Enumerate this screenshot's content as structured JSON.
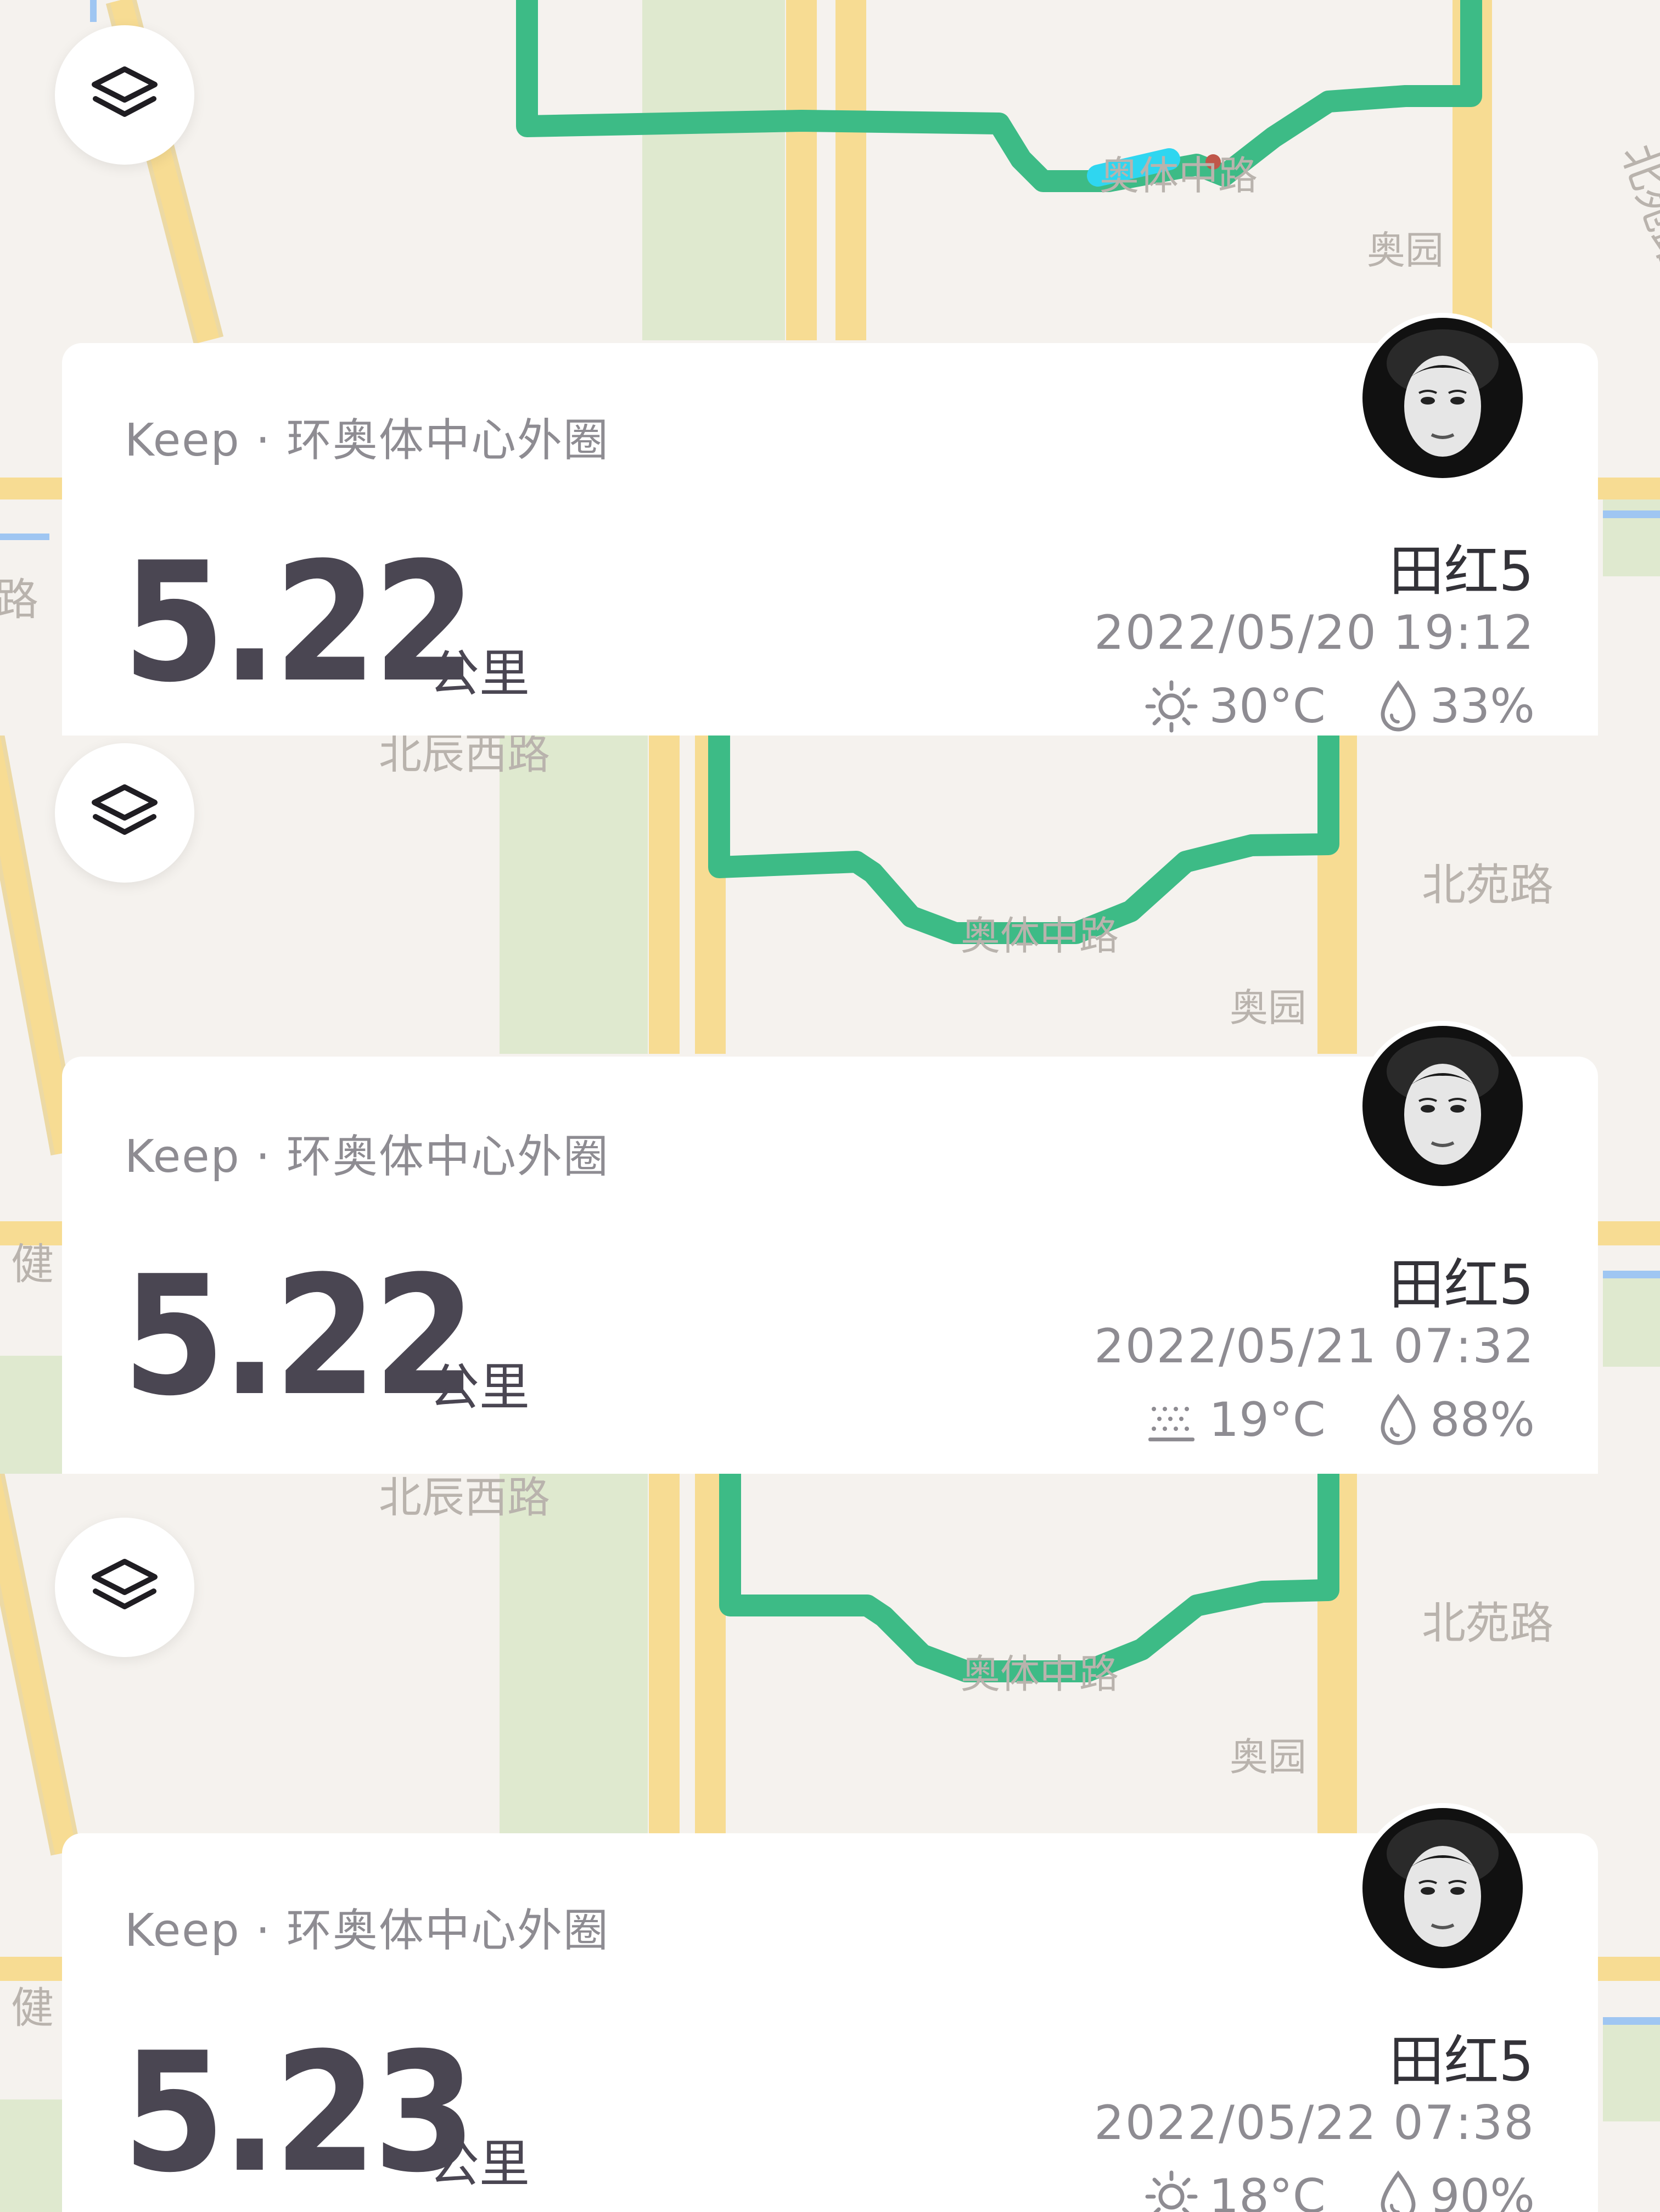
{
  "cards": [
    {
      "source": "Keep · 环奥体中心外圈",
      "distance": "5.22",
      "unit": "公里",
      "user": "田红5",
      "datetime": "2022/05/20 19:12",
      "weather_icon": "sun-icon",
      "temperature": "30°C",
      "humidity": "33%"
    },
    {
      "source": "Keep · 环奥体中心外圈",
      "distance": "5.22",
      "unit": "公里",
      "user": "田红5",
      "datetime": "2022/05/21 07:32",
      "weather_icon": "haze-icon",
      "temperature": "19°C",
      "humidity": "88%"
    },
    {
      "source": "Keep · 环奥体中心外圈",
      "distance": "5.23",
      "unit": "公里",
      "user": "田红5",
      "datetime": "2022/05/22 07:38",
      "weather_icon": "sun-icon",
      "temperature": "18°C",
      "humidity": "90%"
    }
  ],
  "map_labels": {
    "road_beichen_xi": "北辰西路",
    "road_aoti_zhong": "奥体中路",
    "road_beiyuan": "北苑路",
    "road_aoyuan": "奥园",
    "road_jian": "健",
    "road_lu": "路"
  },
  "colors": {
    "route_green": "#3dbb86",
    "route_cyan": "#2fd6f0",
    "road_yellow": "#f7dc93",
    "park_green": "#dfe9cf",
    "water_blue": "#9fc6f2",
    "text_dark": "#4a4652"
  }
}
